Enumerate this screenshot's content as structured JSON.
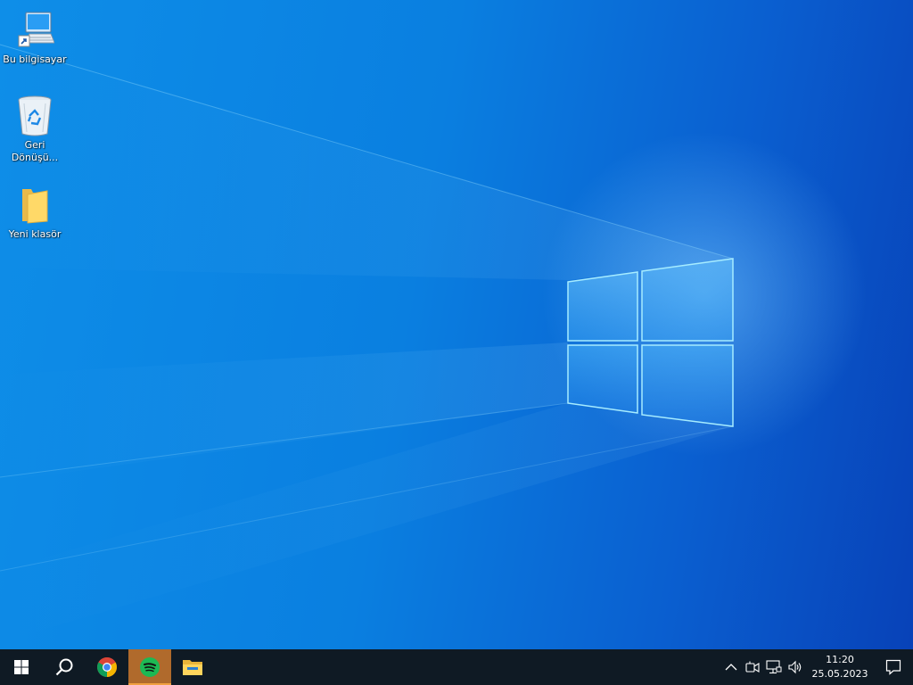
{
  "desktop": {
    "icons": [
      {
        "label": "Bu bilgisayar",
        "icon": "computer-icon"
      },
      {
        "label": "Geri\nDönüşü...",
        "icon": "recycle-bin-icon"
      },
      {
        "label": "Yeni klasör",
        "icon": "folder-icon"
      }
    ]
  },
  "taskbar": {
    "start_icon": "windows-logo-icon",
    "search_icon": "search-icon",
    "apps": [
      {
        "icon": "chrome-icon",
        "active": false
      },
      {
        "icon": "spotify-icon",
        "active": true
      },
      {
        "icon": "file-explorer-icon",
        "active": false
      }
    ],
    "tray": {
      "icons": [
        "chevron-up-icon",
        "meet-now-icon",
        "network-icon",
        "volume-icon"
      ],
      "time": "11:20",
      "date": "25.05.2023",
      "notification_icon": "notification-icon"
    },
    "colors": {
      "background": "#0f1a24",
      "active_app": "#b06a2c"
    }
  }
}
